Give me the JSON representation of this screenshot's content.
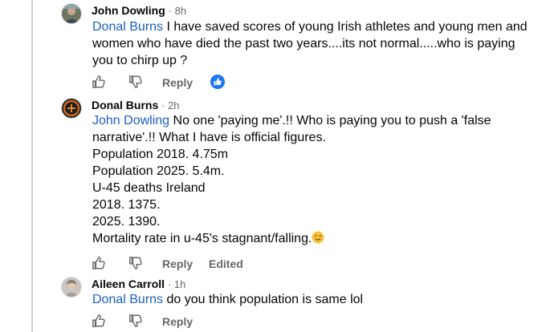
{
  "comments": [
    {
      "author": "John Dowling",
      "time": "· 8h",
      "mention": "Donal Burns",
      "lines": [
        " I have saved scores of young Irish athletes and young men and",
        "women who have died the past two years....its not normal.....who is paying",
        "you to chirp up ?"
      ],
      "reply_label": "Reply",
      "has_reaction": true
    },
    {
      "author": "Donal Burns",
      "time": "· 2h",
      "mention": "John Dowling",
      "lines": [
        " No one 'paying me'.!! Who is paying you to push a 'false",
        "narrative'.!! What I have is official figures.",
        "Population 2018. 4.75m",
        "Population 2025. 5.4m.",
        "U-45 deaths Ireland",
        "2018. 1375.",
        "2025. 1390.",
        "Mortality rate in u-45's stagnant/falling."
      ],
      "reply_label": "Reply",
      "edited_label": "Edited"
    },
    {
      "author": "Aileen Carroll",
      "time": "· 1h",
      "mention": "Donal Burns",
      "lines": [
        " do you think population is same lol"
      ],
      "reply_label": "Reply"
    }
  ],
  "icons": {
    "like": "thumbs-up-icon",
    "dislike": "thumbs-down-icon",
    "reaction": "like-reaction-icon",
    "emoji": "winking-face-emoji"
  },
  "colors": {
    "mention": "#1b5fc0",
    "meta": "#65676b",
    "like_badge": "#1877f2",
    "thread_line": "#ced0d4"
  }
}
